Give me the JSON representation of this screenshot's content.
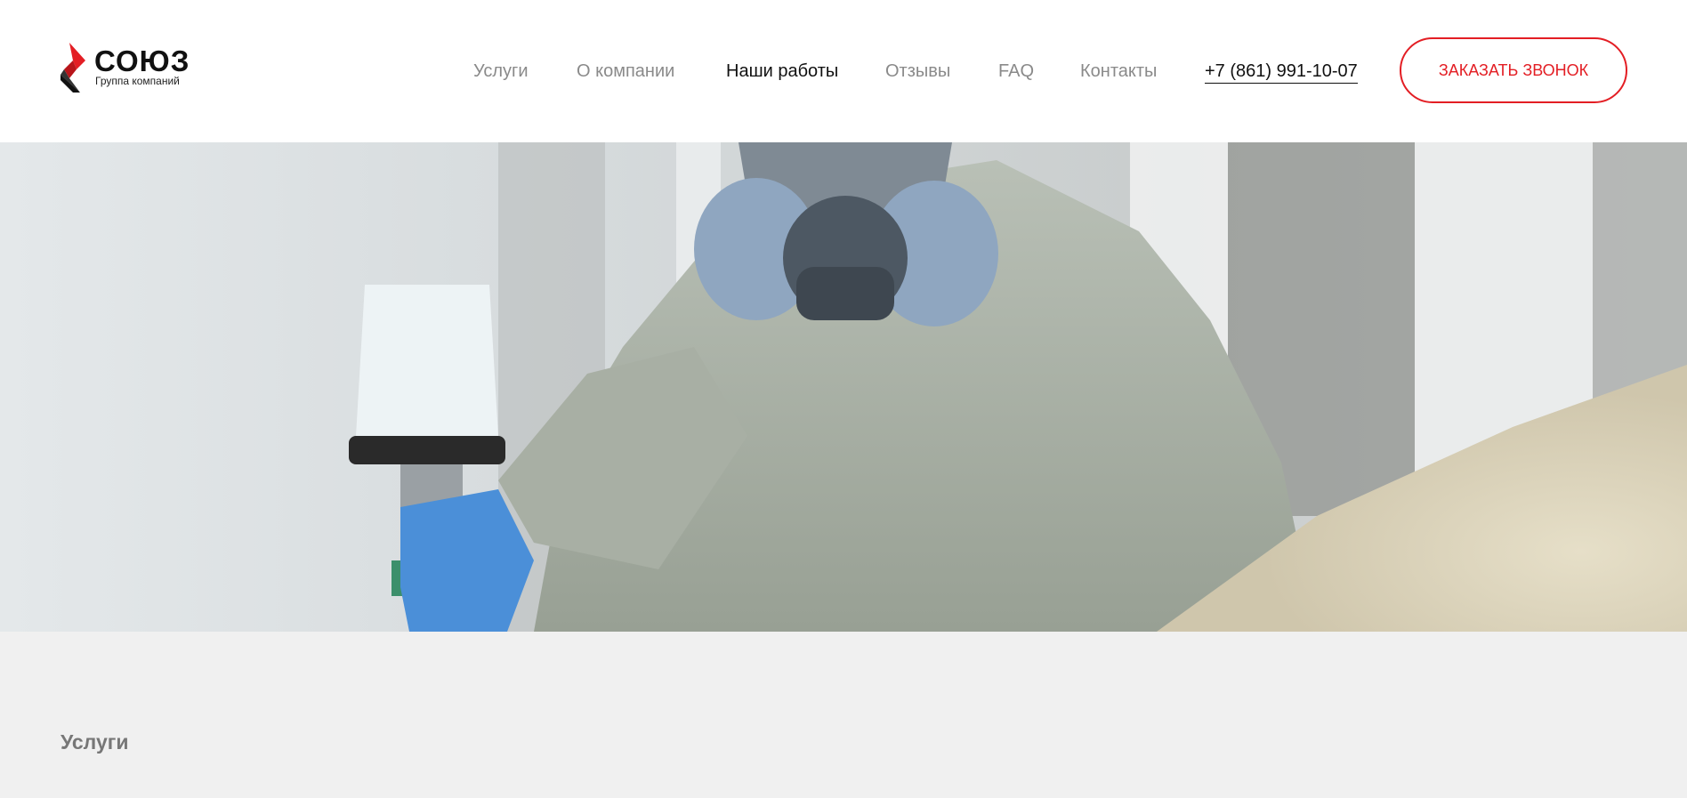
{
  "brand": {
    "name": "СОЮЗ",
    "tagline": "Группа компаний",
    "accent_color": "#e31e24"
  },
  "nav": {
    "items": [
      {
        "label": "Услуги",
        "active": false
      },
      {
        "label": "О компании",
        "active": false
      },
      {
        "label": "Наши работы",
        "active": true
      },
      {
        "label": "Отзывы",
        "active": false
      },
      {
        "label": "FAQ",
        "active": false
      },
      {
        "label": "Контакты",
        "active": false
      }
    ],
    "phone": "+7 (861) 991-10-07",
    "cta_label": "ЗАКАЗАТЬ ЗВОНОК"
  },
  "hero": {
    "image": "painter-in-respirator-with-spray-gun"
  },
  "section": {
    "label": "Услуги"
  }
}
